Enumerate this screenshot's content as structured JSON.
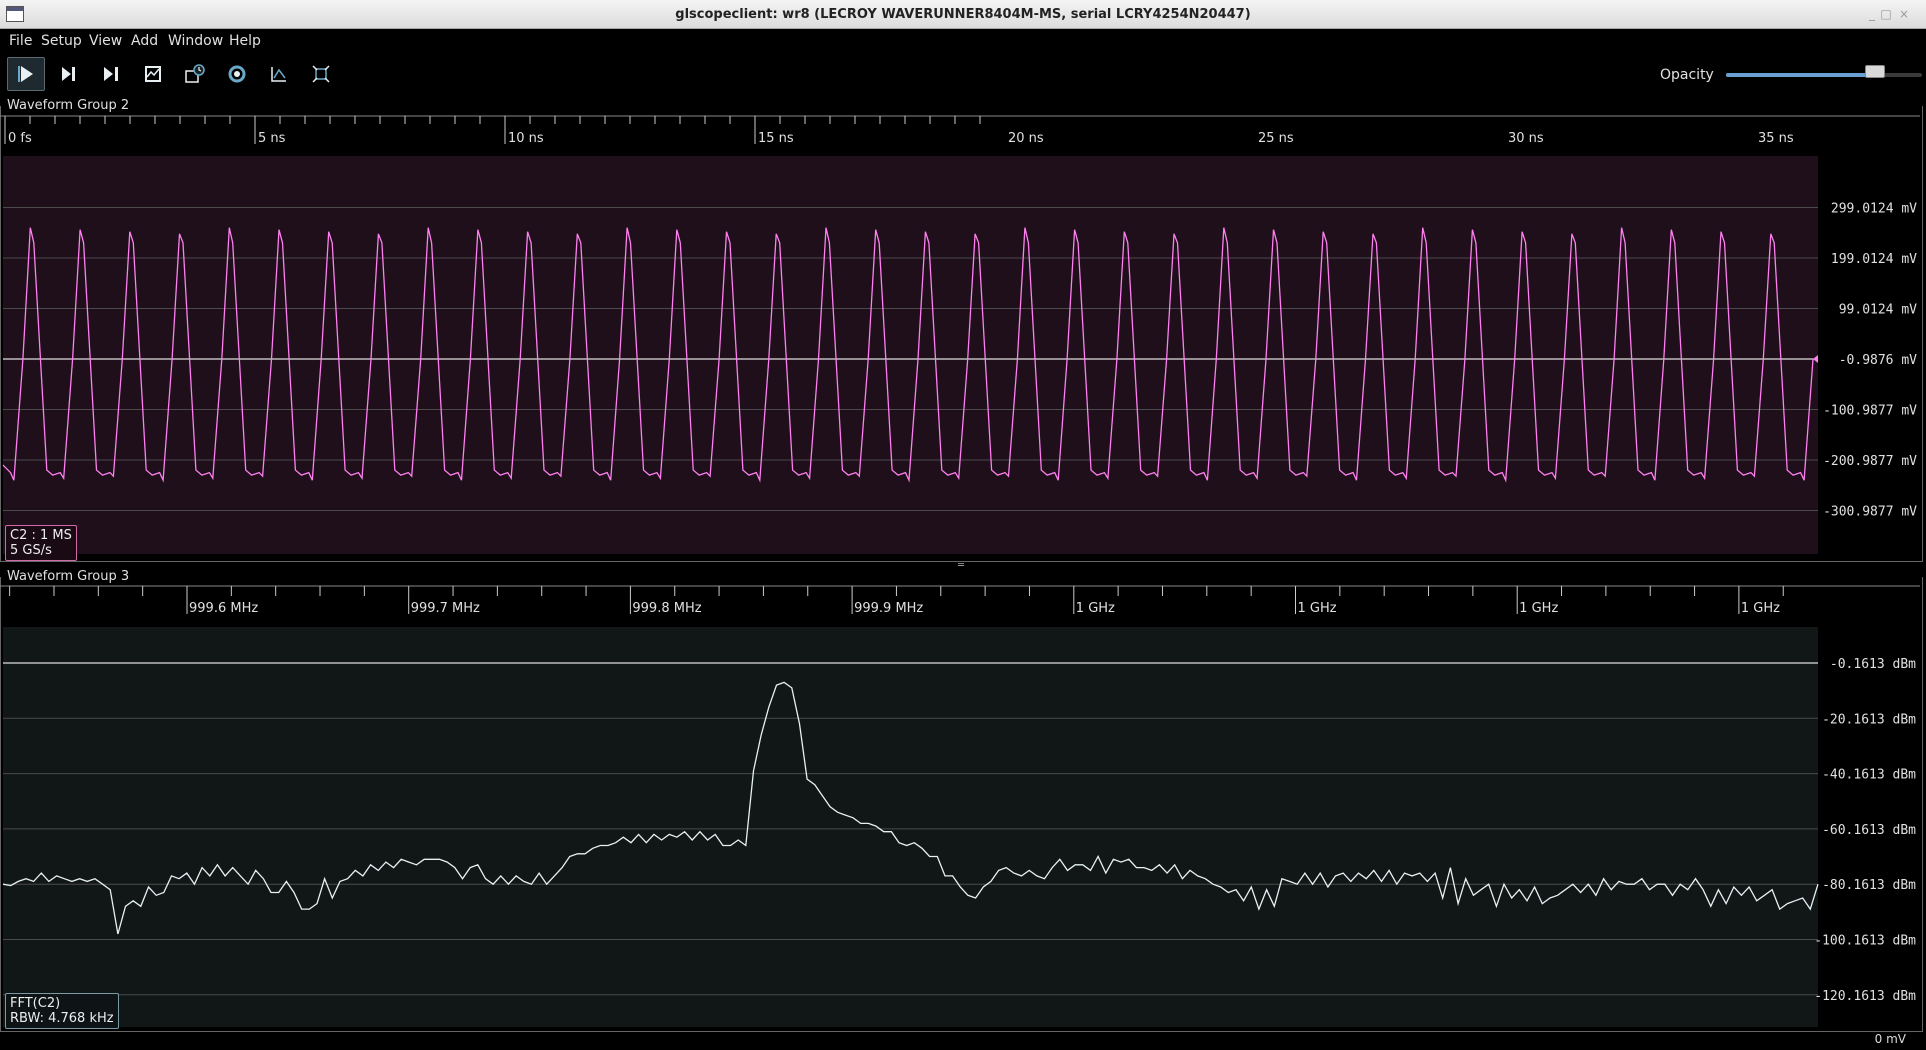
{
  "window": {
    "title": "glscopeclient: wr8 (LECROY WAVERUNNER8404M-MS, serial LCRY4254N20447)",
    "minimize_glyph": "_",
    "maximize_glyph": "□",
    "close_glyph": "×"
  },
  "menu": [
    {
      "label": "File"
    },
    {
      "label": "Setup"
    },
    {
      "label": "View"
    },
    {
      "label": "Add"
    },
    {
      "label": "Window"
    },
    {
      "label": "Help"
    }
  ],
  "toolbar": {
    "tools": [
      {
        "name": "start-trigger-icon",
        "active": true
      },
      {
        "name": "single-trigger-icon"
      },
      {
        "name": "force-trigger-icon"
      },
      {
        "name": "stop-trigger-icon"
      },
      {
        "name": "history-icon"
      },
      {
        "name": "refresh-settings-icon"
      },
      {
        "name": "clear-sweeps-icon"
      },
      {
        "name": "fullscreen-icon"
      }
    ],
    "opacity_label": "Opacity",
    "opacity_value": 0.76
  },
  "colors": {
    "background": "#000000",
    "wave_magenta": "#ff7ff0",
    "wave_fft": "#e6f2f2",
    "group2_plot_bg": "#1e0f1a",
    "group3_plot_bg": "#111617",
    "gridline": "#4a4a4a",
    "accent": "#6a9fd4"
  },
  "group2": {
    "title": "Waveform Group 2",
    "time_axis": [
      "0 fs",
      "5 ns",
      "10 ns",
      "15 ns",
      "20 ns",
      "25 ns",
      "30 ns",
      "35 ns"
    ],
    "y_axis": [
      "299.0124 mV",
      "199.0124 mV",
      "99.0124 mV",
      "-0.9876 mV",
      "-100.9877 mV",
      "-200.9877 mV",
      "-300.9877 mV"
    ],
    "channel_name": "C2 : 1 MS",
    "channel_rate": "5 GS/s",
    "waveform": {
      "type": "triangle",
      "cycles": 36.5,
      "amplitude_mV_high": 260,
      "amplitude_mV_low": -230
    }
  },
  "group3": {
    "title": "Waveform Group 3",
    "freq_axis": [
      "999.6 MHz",
      "999.7 MHz",
      "999.8 MHz",
      "999.9 MHz",
      "1 GHz",
      "1 GHz",
      "1 GHz",
      "1 GHz"
    ],
    "y_axis": [
      "-0.1613 dBm",
      "-20.1613 dBm",
      "-40.1613 dBm",
      "-60.1613 dBm",
      "-80.1613 dBm",
      "-100.1613 dBm",
      "-120.1613 dBm"
    ],
    "channel_name": "FFT(C2)",
    "channel_rate": "RBW: 4.768 kHz",
    "spectrum_dBm": [
      -80,
      -80.5,
      -79,
      -78,
      -79,
      -76,
      -79,
      -77,
      -78,
      -79,
      -78,
      -79,
      -78,
      -80,
      -82,
      -98,
      -88,
      -86,
      -88,
      -81,
      -84,
      -83,
      -77,
      -78,
      -76,
      -80,
      -74,
      -77,
      -73,
      -77,
      -74,
      -77,
      -80,
      -75,
      -78,
      -83,
      -83,
      -79,
      -83,
      -89,
      -89,
      -87,
      -78,
      -85,
      -79,
      -78,
      -75,
      -77,
      -73,
      -75,
      -72,
      -74,
      -71,
      -72,
      -73,
      -71,
      -71,
      -71,
      -72,
      -74,
      -78,
      -74,
      -73,
      -78,
      -80,
      -77,
      -80,
      -77,
      -79,
      -80,
      -76,
      -80,
      -77,
      -74,
      -70,
      -69,
      -69,
      -67,
      -66,
      -66,
      -65,
      -63,
      -65,
      -62,
      -65,
      -62,
      -64,
      -62,
      -63,
      -61,
      -64,
      -61,
      -64,
      -62,
      -66,
      -66,
      -64,
      -66,
      -39,
      -26,
      -16,
      -8,
      -7,
      -9,
      -22,
      -42,
      -44,
      -48,
      -52,
      -54,
      -55,
      -56,
      -58,
      -58,
      -59,
      -61,
      -61,
      -65,
      -66,
      -65,
      -67,
      -70,
      -70,
      -77,
      -77,
      -81,
      -84,
      -85,
      -81,
      -79,
      -75,
      -74,
      -76,
      -77,
      -75,
      -77,
      -78,
      -74,
      -71,
      -75,
      -73,
      -73,
      -75,
      -70,
      -76,
      -71,
      -72,
      -71,
      -74,
      -74,
      -75,
      -73,
      -76,
      -73,
      -78,
      -75,
      -77,
      -78,
      -80,
      -81,
      -83,
      -82,
      -86,
      -81,
      -89,
      -82,
      -88,
      -78,
      -79,
      -80,
      -76,
      -80,
      -76,
      -81,
      -77,
      -76,
      -79,
      -76,
      -78,
      -75,
      -79,
      -75,
      -80,
      -76,
      -77,
      -76,
      -79,
      -76,
      -85,
      -74,
      -87,
      -78,
      -84,
      -82,
      -80,
      -88,
      -80,
      -85,
      -82,
      -86,
      -81,
      -87,
      -85,
      -84,
      -82,
      -80,
      -83,
      -80,
      -84,
      -78,
      -82,
      -79,
      -80,
      -80,
      -78,
      -82,
      -80,
      -80,
      -84,
      -80,
      -82,
      -78,
      -82,
      -88,
      -82,
      -87,
      -81,
      -84,
      -81,
      -86,
      -84,
      -82,
      -89,
      -87,
      -86,
      -85,
      -89,
      -80
    ]
  },
  "status": {
    "offset_text": "0 mV"
  }
}
